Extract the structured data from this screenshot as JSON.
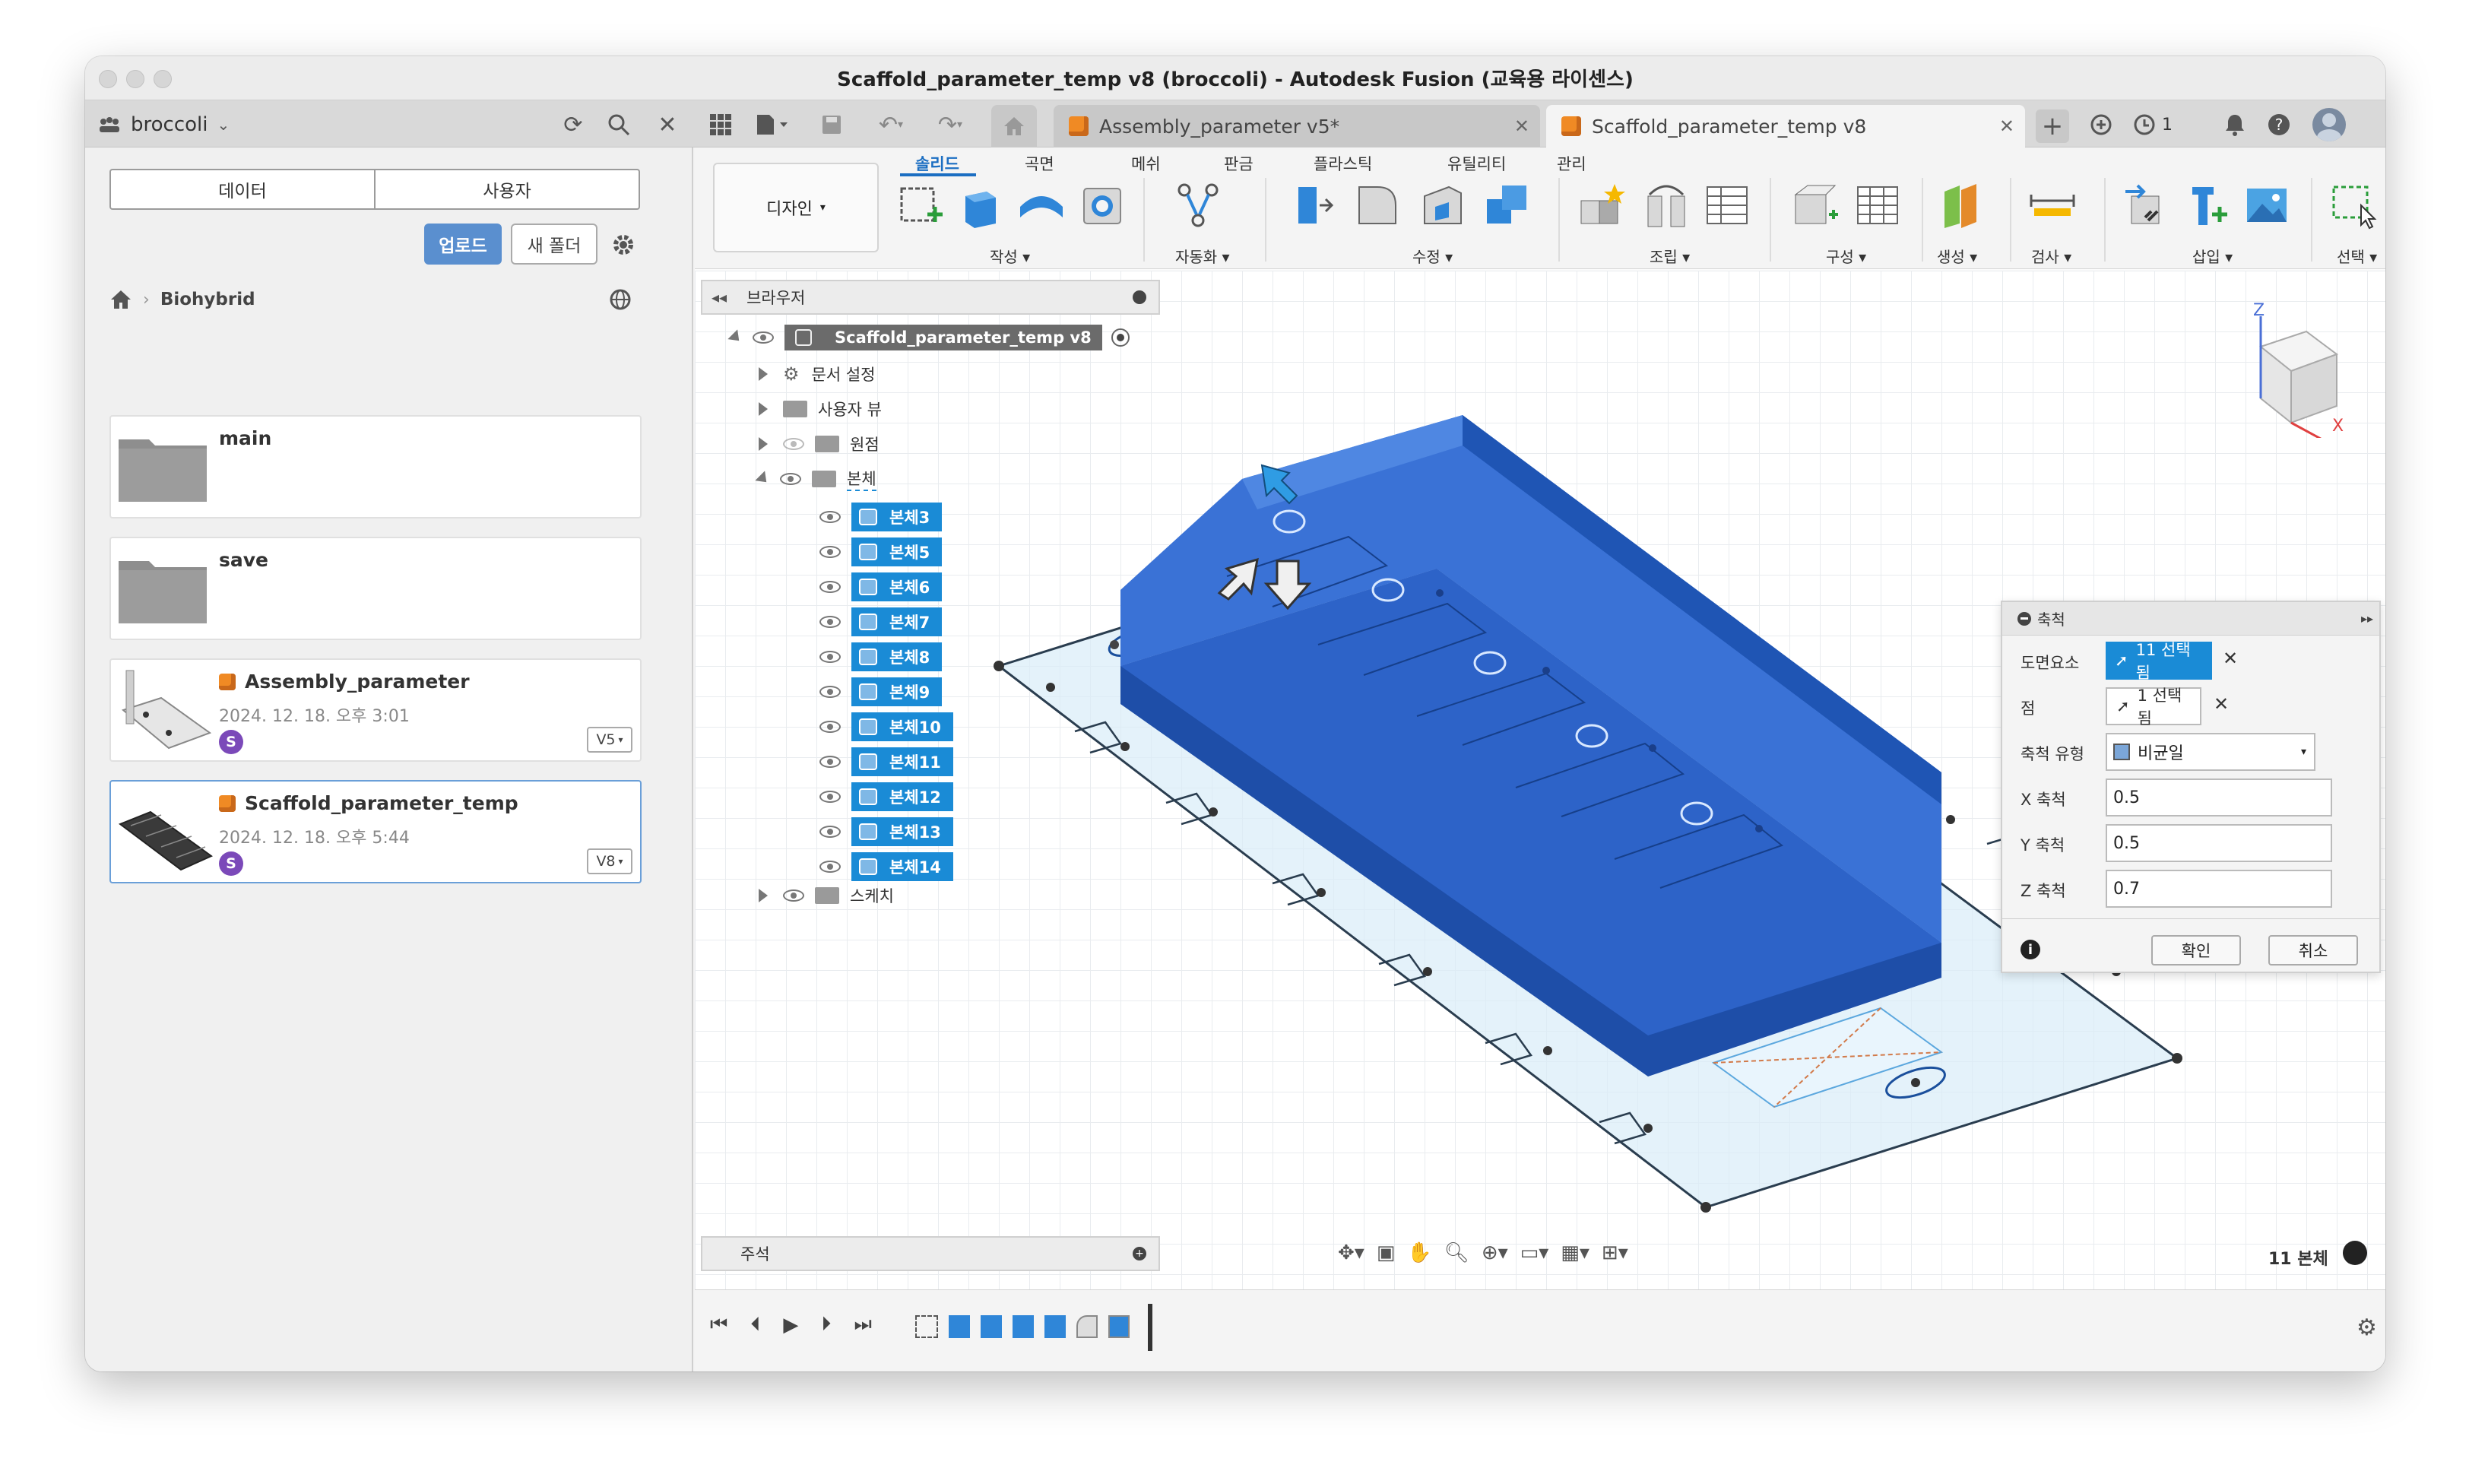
{
  "window": {
    "title": "Scaffold_parameter_temp v8 (broccoli) - Autodesk Fusion (교육용 라이센스)"
  },
  "topbar": {
    "team": "broccoli",
    "notification_count": "1"
  },
  "doc_tabs": [
    {
      "label": "Assembly_parameter v5*"
    },
    {
      "label": "Scaffold_parameter_temp v8"
    }
  ],
  "data_panel": {
    "tabs": [
      "데이터",
      "사용자"
    ],
    "upload_label": "업로드",
    "new_folder_label": "새 폴더",
    "breadcrumb": "Biohybrid",
    "folders": [
      {
        "name": "main"
      },
      {
        "name": "save"
      }
    ],
    "files": [
      {
        "name": "Assembly_parameter",
        "date": "2024. 12. 18. 오후 3:01",
        "version": "V5",
        "user_initial": "S"
      },
      {
        "name": "Scaffold_parameter_temp",
        "date": "2024. 12. 18. 오후 5:44",
        "version": "V8",
        "user_initial": "S"
      }
    ]
  },
  "ribbon": {
    "workspace_label": "디자인",
    "tabs": [
      "솔리드",
      "곡면",
      "메쉬",
      "판금",
      "플라스틱",
      "유틸리티",
      "관리"
    ],
    "groups": [
      "작성",
      "자동화",
      "수정",
      "조립",
      "구성",
      "생성",
      "검사",
      "삽입",
      "선택"
    ]
  },
  "browser": {
    "title": "브라우저",
    "root": "Scaffold_parameter_temp v8",
    "nodes": [
      "문서 설정",
      "사용자 뷰",
      "원점",
      "본체"
    ],
    "bodies": [
      "본체3",
      "본체5",
      "본체6",
      "본체7",
      "본체8",
      "본체9",
      "본체10",
      "본체11",
      "본체12",
      "본체13",
      "본체14"
    ],
    "sketch": "스케치"
  },
  "comments": {
    "label": "주석"
  },
  "dialog": {
    "title": "축척",
    "entity_label": "도면요소",
    "entity_value": "11 선택됨",
    "point_label": "점",
    "point_value": "1 선택됨",
    "type_label": "축척 유형",
    "type_value": "비균일",
    "x_label": "X 축척",
    "x_value": "0.5",
    "y_label": "Y 축척",
    "y_value": "0.5",
    "z_label": "Z 축척",
    "z_value": "0.7",
    "ok": "확인",
    "cancel": "취소"
  },
  "status": {
    "body_count": "11 본체"
  },
  "viewcube": {
    "z": "Z",
    "x": "X"
  },
  "colors": {
    "accent": "#1a8bd6",
    "body_blue": "#2d63c8",
    "brand_orange": "#f08a24"
  }
}
